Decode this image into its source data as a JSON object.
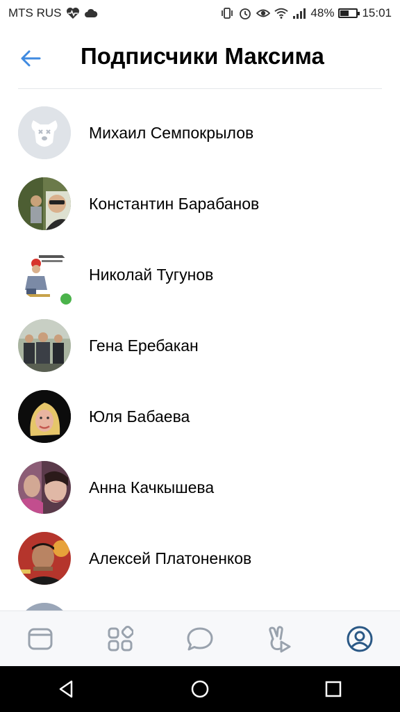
{
  "status_bar": {
    "carrier": "MTS RUS",
    "battery_percent": "48%",
    "battery_level": 0.48,
    "time": "15:01"
  },
  "header": {
    "title": "Подписчики Максима",
    "accent_color": "#3f8ae0"
  },
  "followers": [
    {
      "name": "Михаил Семпокрылов",
      "avatar": "deactivated-dog-icon",
      "online": false
    },
    {
      "name": "Константин Барабанов",
      "avatar": "photo",
      "online": false
    },
    {
      "name": "Николай Тугунов",
      "avatar": "photo",
      "online": true
    },
    {
      "name": "Гена Еребакан",
      "avatar": "photo",
      "online": false
    },
    {
      "name": "Юля Бабаева",
      "avatar": "photo",
      "online": false
    },
    {
      "name": "Анна Качкышева",
      "avatar": "photo",
      "online": false
    },
    {
      "name": "Алексей Платоненков",
      "avatar": "photo",
      "online": false
    }
  ],
  "tab_bar": {
    "items": [
      "news-icon",
      "services-icon",
      "messages-icon",
      "clips-icon",
      "profile-icon"
    ],
    "active": "profile-icon",
    "active_color": "#2a5885",
    "inactive_color": "#99a2ad"
  },
  "nav_bar": {
    "items": [
      "back-triangle-icon",
      "home-circle-icon",
      "recents-square-icon"
    ]
  }
}
